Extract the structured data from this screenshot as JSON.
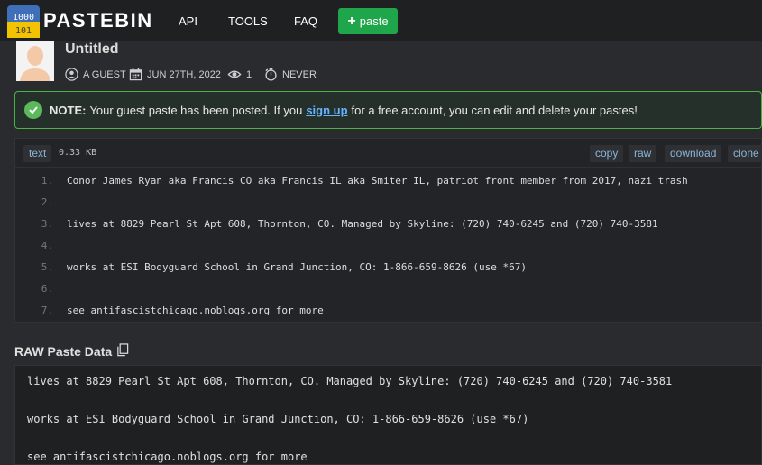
{
  "header": {
    "brand": "PASTEBIN",
    "nav": [
      "API",
      "TOOLS",
      "FAQ"
    ],
    "paste_button": "paste"
  },
  "paste": {
    "title": "Untitled",
    "author": "A GUEST",
    "date": "JUN 27TH, 2022",
    "views": "1",
    "expiry": "NEVER"
  },
  "note": {
    "label": "NOTE:",
    "before": "Your guest paste has been posted. If you",
    "link": "sign up",
    "after": "for a free account, you can edit and delete your pastes!"
  },
  "code": {
    "syntax": "text",
    "size": "0.33 KB",
    "actions": [
      "copy",
      "raw",
      "download",
      "clone"
    ],
    "lines": [
      {
        "n": "1.",
        "t": "Conor James Ryan aka Francis CO aka Francis IL aka Smiter IL, patriot front member from 2017, nazi trash"
      },
      {
        "n": "2.",
        "t": ""
      },
      {
        "n": "3.",
        "t": "lives at 8829 Pearl St Apt 608, Thornton, CO. Managed by Skyline: (720) 740-6245 and (720) 740-3581"
      },
      {
        "n": "4.",
        "t": ""
      },
      {
        "n": "5.",
        "t": "works at ESI Bodyguard School in Grand Junction, CO: 1-866-659-8626 (use *67)"
      },
      {
        "n": "6.",
        "t": ""
      },
      {
        "n": "7.",
        "t": "see antifascistchicago.noblogs.org for more"
      }
    ]
  },
  "raw": {
    "title": "RAW Paste Data",
    "lines": [
      "lives at 8829 Pearl St Apt 608, Thornton, CO. Managed by Skyline: (720) 740-6245 and (720) 740-3581",
      "works at ESI Bodyguard School in Grand Junction, CO: 1-866-659-8626 (use *67)",
      "see antifascistchicago.noblogs.org for more"
    ]
  },
  "colors": {
    "accent_green": "#1fa64a",
    "link": "#66b3ff",
    "background": "#2a2b2e"
  }
}
